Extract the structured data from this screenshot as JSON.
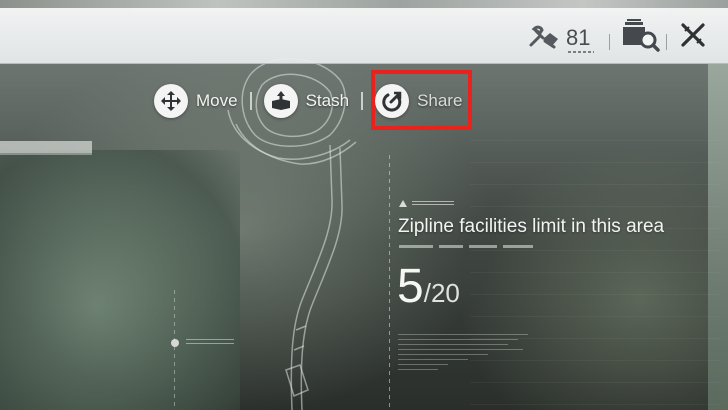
{
  "topbar": {
    "durability_value": "81",
    "icons": [
      "repair-wrench-icon",
      "inspect-container-icon",
      "close-icon"
    ]
  },
  "actions": [
    {
      "icon": "move-arrows-icon",
      "label": "Move"
    },
    {
      "icon": "stash-box-icon",
      "label": "Stash"
    },
    {
      "icon": "share-power-icon",
      "label": "Share"
    }
  ],
  "info": {
    "title": "Zipline facilities limit in this area",
    "current": "5",
    "separator": "/",
    "max": "20"
  },
  "colors": {
    "highlight": "#e8231d",
    "topbar_bg": "#f2f4f4",
    "text_light": "#f3f5f3"
  }
}
